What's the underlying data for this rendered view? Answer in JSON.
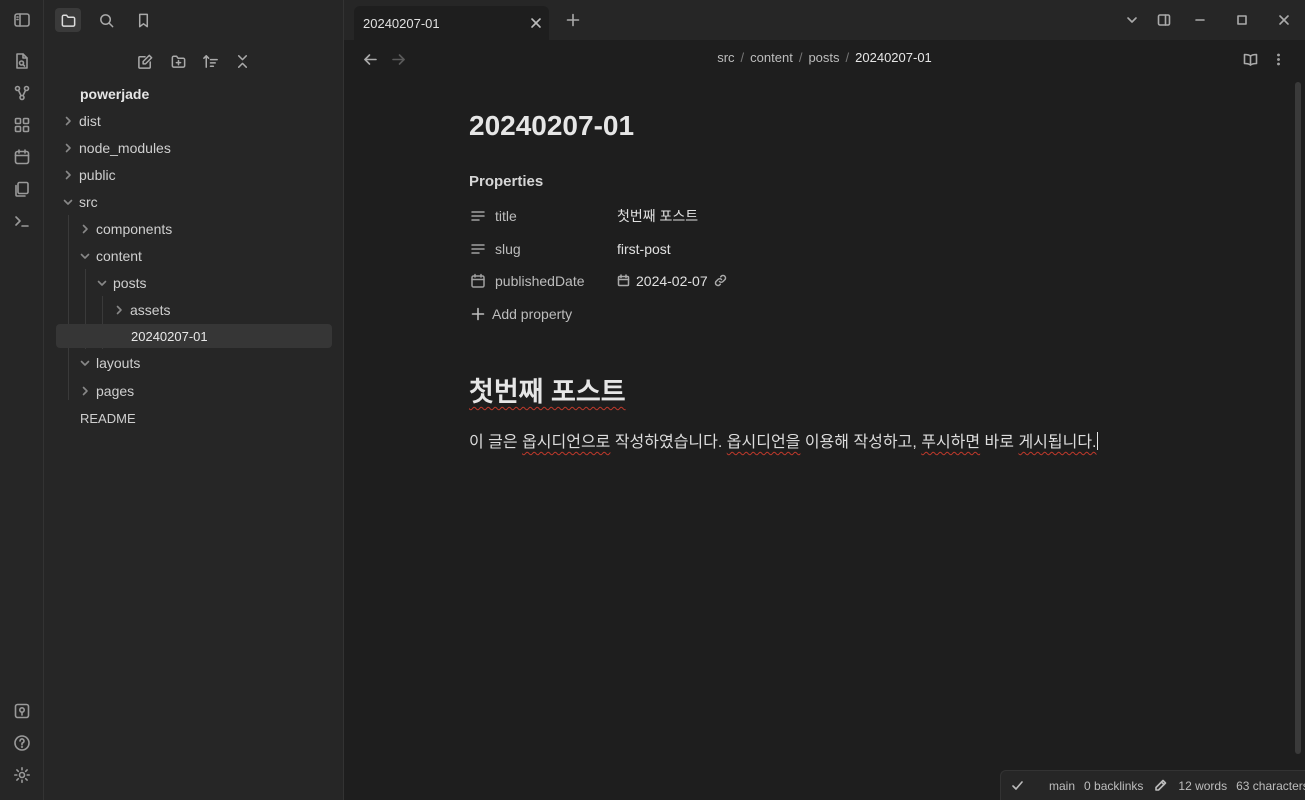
{
  "sidebar_tabs": {
    "files_icon": "folder-icon",
    "search_icon": "search-icon",
    "bookmarks_icon": "bookmark-icon"
  },
  "file_tree": {
    "vault_name": "powerjade",
    "items": [
      {
        "label": "dist",
        "type": "folder",
        "expanded": false
      },
      {
        "label": "node_modules",
        "type": "folder",
        "expanded": false
      },
      {
        "label": "public",
        "type": "folder",
        "expanded": false
      },
      {
        "label": "src",
        "type": "folder",
        "expanded": true
      },
      {
        "label": "components",
        "type": "folder",
        "expanded": false
      },
      {
        "label": "content",
        "type": "folder",
        "expanded": true
      },
      {
        "label": "posts",
        "type": "folder",
        "expanded": true
      },
      {
        "label": "assets",
        "type": "folder",
        "expanded": false
      },
      {
        "label": "20240207-01",
        "type": "file",
        "selected": true
      },
      {
        "label": "layouts",
        "type": "folder",
        "expanded": true
      },
      {
        "label": "pages",
        "type": "folder",
        "expanded": false
      },
      {
        "label": "README",
        "type": "file"
      }
    ]
  },
  "tab": {
    "title": "20240207-01"
  },
  "breadcrumb": [
    "src",
    "content",
    "posts",
    "20240207-01"
  ],
  "note": {
    "title": "20240207-01",
    "properties_heading": "Properties",
    "properties": [
      {
        "key": "title",
        "value": "첫번째 포스트",
        "icon": "text-lines-icon"
      },
      {
        "key": "slug",
        "value": "first-post",
        "icon": "text-lines-icon"
      },
      {
        "key": "publishedDate",
        "value": "2024-02-07",
        "icon": "calendar-icon"
      }
    ],
    "add_property": "Add property",
    "heading": "첫번째 포스트",
    "paragraph": {
      "p1": "이 글은 ",
      "p2": "옵시디언으로",
      "p3": " 작성하였습니다. ",
      "p4": "옵시디언을",
      "p5": " 이용해 작성하고, ",
      "p6": "푸시하면",
      "p7": " 바로 ",
      "p8": "게시됩니다."
    }
  },
  "status_bar": {
    "branch": "main",
    "backlinks": "0 backlinks",
    "words": "12 words",
    "characters": "63 characters"
  },
  "colors": {
    "background": "#1e1e1e",
    "sidebar": "#262626",
    "spellcheck": "#c0392b"
  }
}
